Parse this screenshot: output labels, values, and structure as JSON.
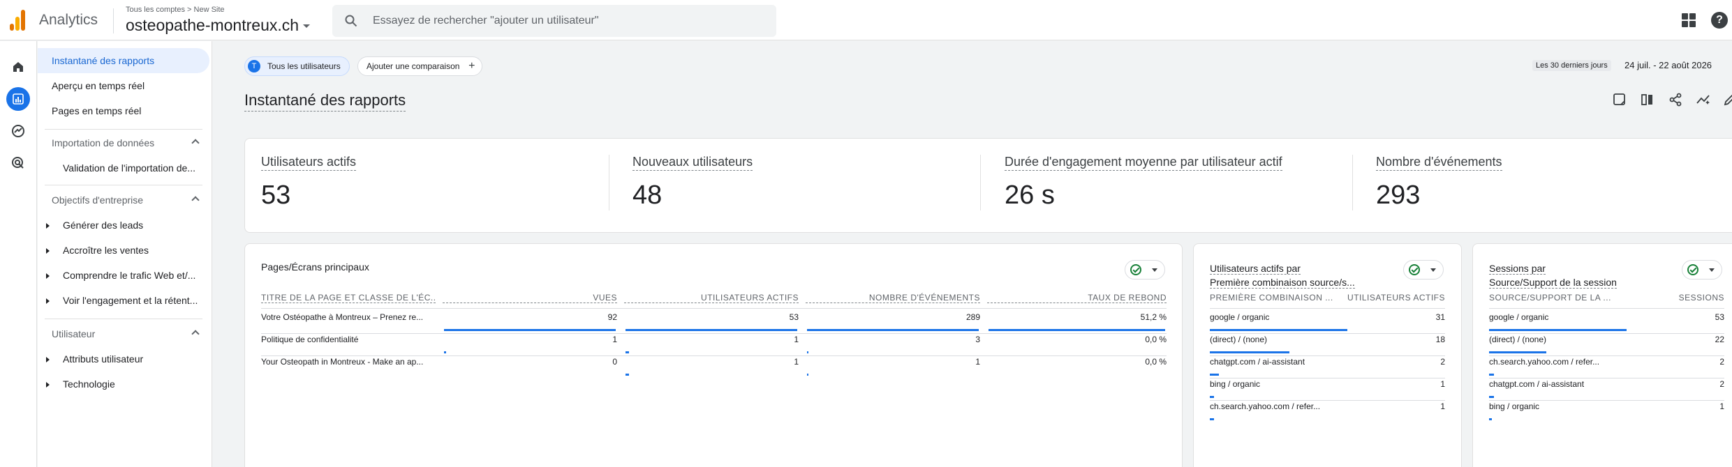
{
  "app": {
    "name": "Analytics"
  },
  "account": {
    "breadcrumb": "Tous les comptes > New Site",
    "property": "osteopathe-montreux.ch"
  },
  "search": {
    "placeholder": "Essayez de rechercher \"ajouter un utilisateur\""
  },
  "sidenav": {
    "items_top": [
      "Instantané des rapports",
      "Aperçu en temps réel",
      "Pages en temps réel"
    ],
    "section_import": "Importation de données",
    "import_items": [
      "Validation de l'importation de..."
    ],
    "section_business": "Objectifs d'entreprise",
    "business_items": [
      "Générer des leads",
      "Accroître les ventes",
      "Comprendre le trafic Web et/...",
      "Voir l'engagement et la rétent..."
    ],
    "section_user": "Utilisateur",
    "user_items": [
      "Attributs utilisateur",
      "Technologie"
    ]
  },
  "toolbar": {
    "all_users": "Tous les utilisateurs",
    "avatar_letter": "T",
    "add_comparison": "Ajouter une comparaison",
    "date_label": "Les 30 derniers jours",
    "date_range": "24 juil. - 22 août 2026"
  },
  "page": {
    "title": "Instantané des rapports"
  },
  "kpis": [
    {
      "label": "Utilisateurs actifs",
      "value": "53"
    },
    {
      "label": "Nouveaux utilisateurs",
      "value": "48"
    },
    {
      "label": "Durée d'engagement moyenne par utilisateur actif",
      "value": "26 s"
    },
    {
      "label": "Nombre d'événements",
      "value": "293"
    }
  ],
  "pages_table": {
    "title": "Pages/Écrans principaux",
    "headers": [
      "TITRE DE LA PAGE ET CLASSE DE L'ÉC...",
      "VUES",
      "UTILISATEURS ACTIFS",
      "NOMBRE D'ÉVÉNEMENTS",
      "TAUX DE REBOND"
    ],
    "rows": [
      {
        "title": "Votre Ostéopathe à Montreux – Prenez re...",
        "views": "92",
        "users": "53",
        "events": "289",
        "bounce": "51,2 %",
        "views_frac": 1.0,
        "users_frac": 1.0,
        "events_frac": 1.0,
        "bounce_frac": 1.0
      },
      {
        "title": "Politique de confidentialité",
        "views": "1",
        "users": "1",
        "events": "3",
        "bounce": "0,0 %",
        "views_frac": 0.011,
        "users_frac": 0.019,
        "events_frac": 0.01,
        "bounce_frac": 0
      },
      {
        "title": "Your Osteopath in Montreux - Make an ap...",
        "views": "0",
        "users": "1",
        "events": "1",
        "bounce": "0,0 %",
        "views_frac": 0,
        "users_frac": 0.019,
        "events_frac": 0.003,
        "bounce_frac": 0
      }
    ]
  },
  "source_users": {
    "title_line1": "Utilisateurs actifs par",
    "title_line2": "Première combinaison source/s...",
    "headers": [
      "PREMIÈRE COMBINAISON ...",
      "UTILISATEURS ACTIFS"
    ],
    "rows": [
      {
        "label": "google / organic",
        "value": "31",
        "frac": 1.0
      },
      {
        "label": "(direct) / (none)",
        "value": "18",
        "frac": 0.58
      },
      {
        "label": "chatgpt.com / ai-assistant",
        "value": "2",
        "frac": 0.065
      },
      {
        "label": "bing / organic",
        "value": "1",
        "frac": 0.032
      },
      {
        "label": "ch.search.yahoo.com / refer...",
        "value": "1",
        "frac": 0.032
      }
    ]
  },
  "sessions": {
    "title_line1": "Sessions par",
    "title_line2": "Source/Support de la session",
    "headers": [
      "SOURCE/SUPPORT DE LA ...",
      "SESSIONS"
    ],
    "rows": [
      {
        "label": "google / organic",
        "value": "53",
        "frac": 1.0
      },
      {
        "label": "(direct) / (none)",
        "value": "22",
        "frac": 0.415
      },
      {
        "label": "ch.search.yahoo.com / refer...",
        "value": "2",
        "frac": 0.038
      },
      {
        "label": "chatgpt.com / ai-assistant",
        "value": "2",
        "frac": 0.038
      },
      {
        "label": "bing / organic",
        "value": "1",
        "frac": 0.019
      }
    ]
  },
  "colors": {
    "accent": "#1a73e8",
    "success": "#188038"
  }
}
